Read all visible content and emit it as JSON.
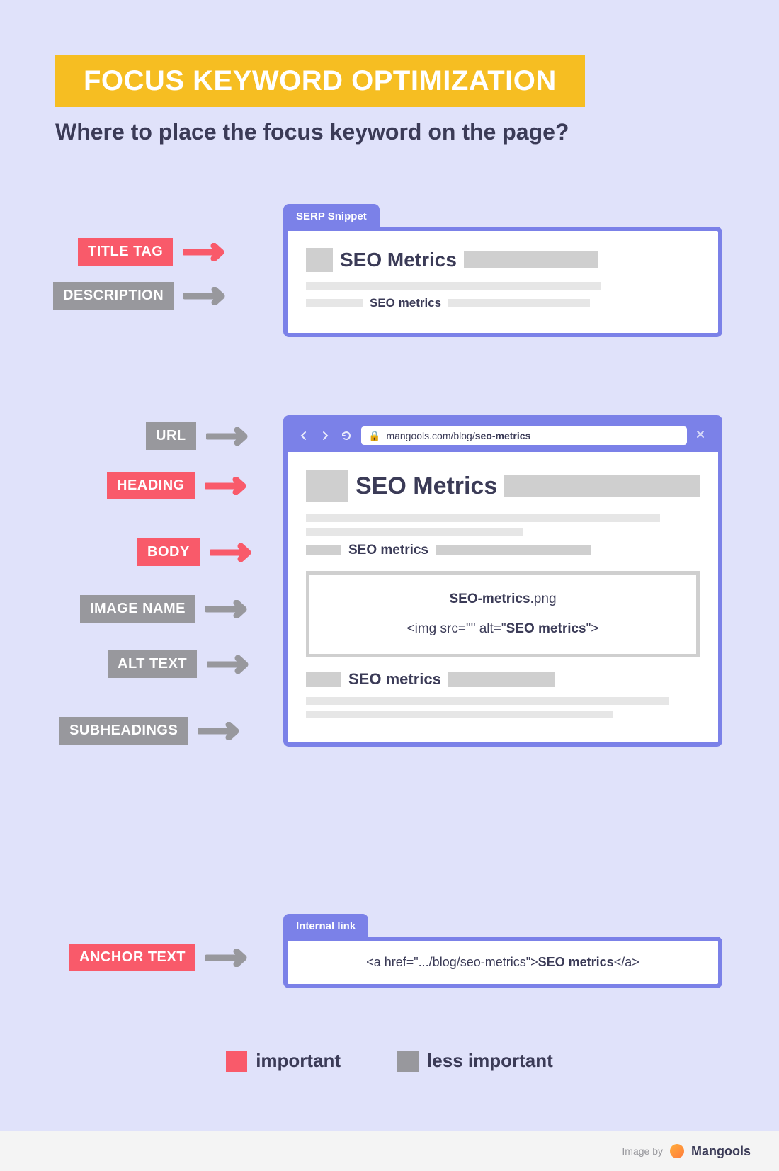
{
  "title": "FOCUS KEYWORD OPTIMIZATION",
  "subtitle": "Where to place the focus keyword on the page?",
  "labels": {
    "title_tag": "TITLE TAG",
    "description": "DESCRIPTION",
    "url": "URL",
    "heading": "HEADING",
    "body": "BODY",
    "image_name": "IMAGE NAME",
    "alt_text": "ALT TEXT",
    "subheadings": "SUBHEADINGS",
    "anchor_text": "ANCHOR TEXT"
  },
  "serp": {
    "tab": "SERP Snippet",
    "title": "SEO Metrics",
    "desc_keyword": "SEO metrics"
  },
  "browser": {
    "url_pre": "mangools.com/blog/",
    "url_slug": "seo-metrics",
    "heading": "SEO Metrics",
    "body_keyword": "SEO metrics",
    "img_filename_bold": "SEO-metrics",
    "img_filename_ext": ".png",
    "img_alt_pre": "<img src=\"\" alt=\"",
    "img_alt_kw": "SEO metrics",
    "img_alt_post": "\">",
    "subheading_keyword": "SEO metrics"
  },
  "internal": {
    "tab": "Internal link",
    "pre": "<a href=\".../blog/seo-metrics\">",
    "kw": "SEO metrics",
    "post": "</a>"
  },
  "legend": {
    "important": "important",
    "less": "less important"
  },
  "footer": {
    "imgby": "Image by",
    "brand": "Mangools"
  },
  "colors": {
    "important": "#F95A6A",
    "less_important": "#98989D",
    "accent": "#7B81E8",
    "bg": "#E0E2FA",
    "title_bg": "#F6BE22"
  }
}
